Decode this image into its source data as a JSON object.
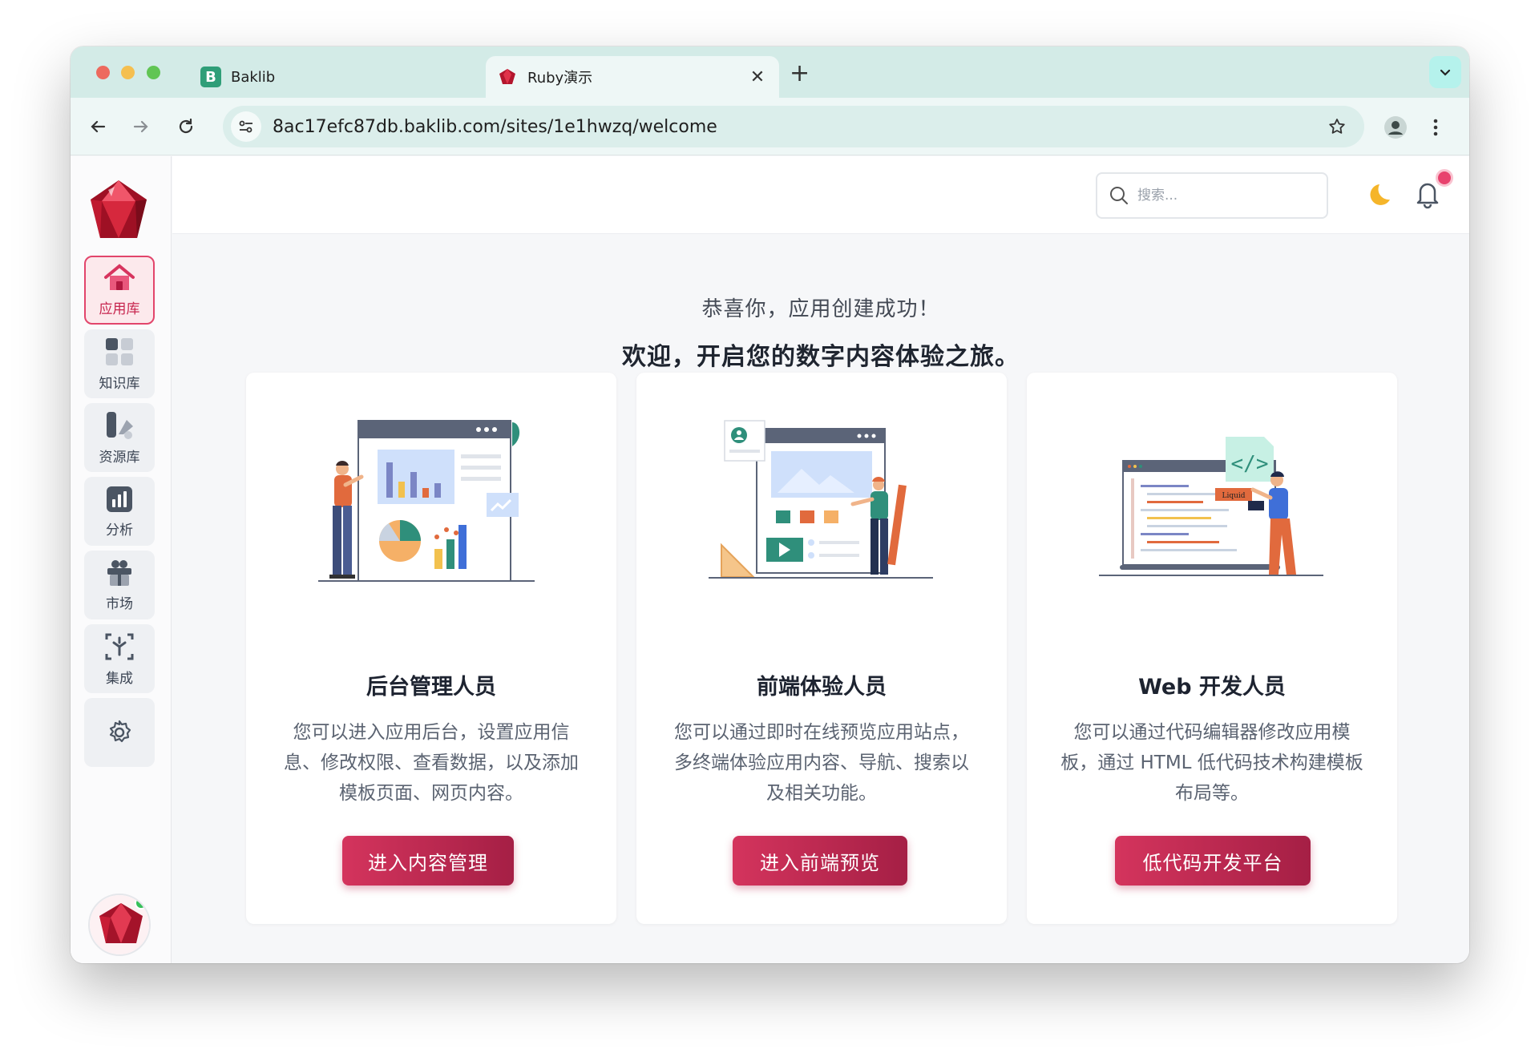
{
  "browser": {
    "tabs": [
      {
        "title": "Baklib",
        "favicon_letter": "B",
        "active": false
      },
      {
        "title": "Ruby演示",
        "active": true
      }
    ],
    "url": "8ac17efc87db.baklib.com/sites/1e1hwzq/welcome"
  },
  "sidebar": {
    "items": [
      {
        "label": "应用库",
        "icon": "home-icon",
        "active": true
      },
      {
        "label": "知识库",
        "icon": "grid-icon"
      },
      {
        "label": "资源库",
        "icon": "resource-icon"
      },
      {
        "label": "分析",
        "icon": "chart-icon"
      },
      {
        "label": "市场",
        "icon": "gift-icon"
      },
      {
        "label": "集成",
        "icon": "integration-icon"
      },
      {
        "label": "",
        "icon": "gear-icon"
      }
    ]
  },
  "header": {
    "search_placeholder": "搜索..."
  },
  "welcome": {
    "line1": "恭喜你，应用创建成功！",
    "line2": "欢迎，开启您的数字内容体验之旅。"
  },
  "cards": [
    {
      "title": "后台管理人员",
      "desc": "您可以进入应用后台，设置应用信息、修改权限、查看数据，以及添加模板页面、网页内容。",
      "button": "进入内容管理"
    },
    {
      "title": "前端体验人员",
      "desc": "您可以通过即时在线预览应用站点，多终端体验应用内容、导航、搜索以及相关功能。",
      "button": "进入前端预览"
    },
    {
      "title": "Web 开发人员",
      "desc": "您可以通过代码编辑器修改应用模板，通过 HTML 低代码技术构建模板布局等。",
      "button": "低代码开发平台",
      "liquid_tag": "Liquid"
    }
  ],
  "colors": {
    "accent": "#c7254e",
    "tab_strip": "#d3ebe7",
    "button_gradient_start": "#d4345d",
    "button_gradient_end": "#a51f45"
  }
}
